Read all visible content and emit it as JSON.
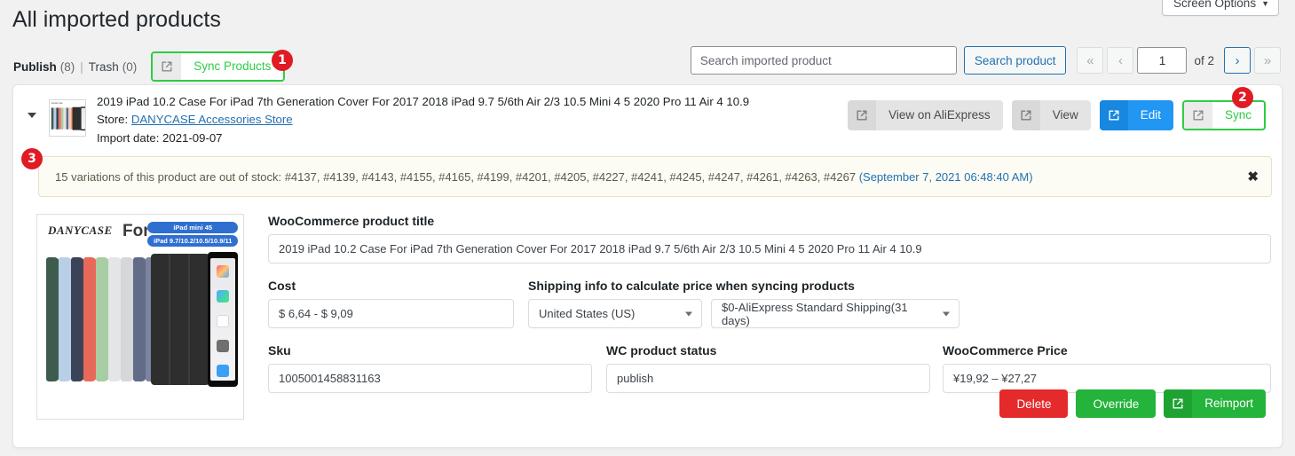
{
  "header": {
    "screen_options": "Screen Options",
    "screen_options_icon": "chevron-down-icon",
    "page_title": "All imported products"
  },
  "filters": {
    "publish_label": "Publish",
    "publish_count": "(8)",
    "separator": "|",
    "trash_label": "Trash",
    "trash_count": "(0)",
    "sync_products_label": "Sync Products",
    "sync_products_icon": "external-link-icon"
  },
  "search": {
    "placeholder": "Search imported product",
    "value": "",
    "button_label": "Search product"
  },
  "pagination": {
    "first_label": "«",
    "prev_label": "‹",
    "current_page": "1",
    "of_label": "of 2",
    "next_label": "›",
    "last_label": "»"
  },
  "product": {
    "toggle_icon": "caret-down-icon",
    "thumbnail_icon": "product-thumbnail",
    "title": "2019 iPad 10.2 Case For iPad 7th Generation Cover For 2017 2018 iPad 9.7 5/6th Air 2/3 10.5 Mini 4 5 2020 Pro 11 Air 4 10.9",
    "store_label": "Store:",
    "store_name": "DANYCASE Accessories Store",
    "import_date_label": "Import date:",
    "import_date": "2021-09-07",
    "actions": {
      "view_aliexpress": "View on AliExpress",
      "view": "View",
      "edit": "Edit",
      "sync": "Sync",
      "icon": "external-link-icon"
    }
  },
  "notice": {
    "message": "15 variations of this product are out of stock: #4137, #4139, #4143, #4155, #4165, #4199, #4201, #4205, #4227, #4241, #4245, #4247, #4261, #4263, #4267",
    "date": "(September 7, 2021 06:48:40 AM)",
    "close_icon": "close-icon",
    "close_label": "✖"
  },
  "details": {
    "title_field": {
      "label": "WooCommerce product title",
      "value": "2019 iPad 10.2 Case For iPad 7th Generation Cover For 2017 2018 iPad 9.7 5/6th Air 2/3 10.5 Mini 4 5 2020 Pro 11 Air 4 10.9"
    },
    "cost_field": {
      "label": "Cost",
      "value": "$ 6,64 - $ 9,09"
    },
    "shipping_section": {
      "label": "Shipping info to calculate price when syncing products",
      "country_value": "United States (US)",
      "method_value": "$0-AliExpress Standard Shipping(31 days)"
    },
    "sku_field": {
      "label": "Sku",
      "value": "1005001458831163"
    },
    "status_field": {
      "label": "WC product status",
      "value": "publish"
    },
    "price_field": {
      "label": "WooCommerce Price",
      "value": "¥19,92 – ¥27,27"
    },
    "buttons": {
      "delete": "Delete",
      "override": "Override",
      "reimport": "Reimport",
      "reimport_icon": "external-link-icon"
    }
  },
  "product_image": {
    "brand": "DANYCASE",
    "for_label": "For",
    "tag_1": "iPad mini 45",
    "tag_2": "iPad 9.7/10.2/10.5/10.9/11",
    "case_colors": [
      "#3d5c4e",
      "#b9cfe8",
      "#3a4358",
      "#e8695a",
      "#a8cda2",
      "#e3e5e6",
      "#d5d7da",
      "#626b88",
      "#7b84a0",
      "#eddadc",
      "#f0c9c9",
      "#f0933f",
      "#2e2e2e"
    ]
  },
  "badges": {
    "one": "1",
    "two": "2",
    "three": "3",
    "color": "#e01b24"
  },
  "colors": {
    "accent_green": "#2ecc45",
    "accent_blue": "#2196f3",
    "danger_red": "#e42a2a",
    "link_blue": "#2271b1",
    "notice_bg": "#fdfcf4"
  }
}
